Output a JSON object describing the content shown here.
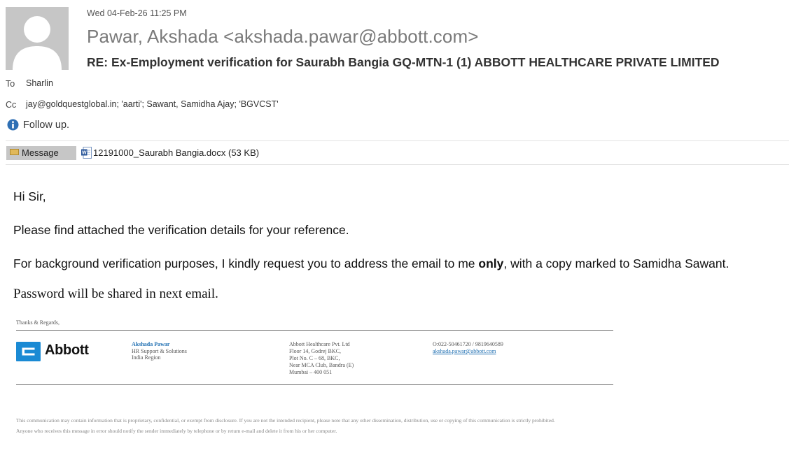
{
  "header": {
    "date": "Wed 04-Feb-26 11:25 PM",
    "sender": "Pawar, Akshada <akshada.pawar@abbott.com>",
    "subject": "RE: Ex-Employment verification for Saurabh Bangia GQ-MTN-1 (1) ABBOTT HEALTHCARE PRIVATE LIMITED",
    "to_label": "To",
    "to_value": "Sharlin",
    "cc_label": "Cc",
    "cc_value": "jay@goldquestglobal.in; 'aarti'; Sawant, Samidha Ajay; 'BGVCST'",
    "info_text": "Follow up.",
    "message_tab": "Message",
    "attachment": "12191000_Saurabh Bangia.docx (53 KB)"
  },
  "body": {
    "greeting": "Hi Sir,",
    "line1": "Please find attached the verification details for your reference.",
    "line2_pre": "For background verification purposes, I kindly request you to address the email to me ",
    "line2_bold": "only",
    "line2_post": ", with a copy marked to Samidha Sawant.",
    "line3": "Password will be shared in next email."
  },
  "signature": {
    "thanks": "Thanks & Regards,",
    "logo_text": "Abbott",
    "name": "Akshada Pawar",
    "role": "HR Support & Solutions",
    "region": "India Region",
    "address": [
      "Abbott Healthcare Pvt. Ltd",
      "Floor 14, Godrej BKC,",
      "Plot No. C – 68, BKC,",
      "Near MCA Club, Bandra (E)",
      "Mumbai – 400 051"
    ],
    "phone": "O:022-50461720 / 9819640589",
    "email": "akshada.pawar@abbott.com"
  },
  "disclaimer": {
    "line1": "This communication may contain information that is proprietary, confidential, or exempt from disclosure. If you are not the intended recipient, please note that any other dissemination, distribution, use or copying of this communication is strictly prohibited.",
    "line2": "Anyone who receives this message in error should notify the sender immediately by telephone or by return e-mail and delete it from his or her computer."
  },
  "colors": {
    "link": "#1f6fb2",
    "abbott_blue": "#1a8ad4",
    "info_blue": "#2e6fb4"
  },
  "icons": {
    "avatar": "person-silhouette-icon",
    "info": "info-icon",
    "message": "envelope-icon",
    "attachment": "word-document-icon",
    "logo": "abbott-logo-icon"
  }
}
